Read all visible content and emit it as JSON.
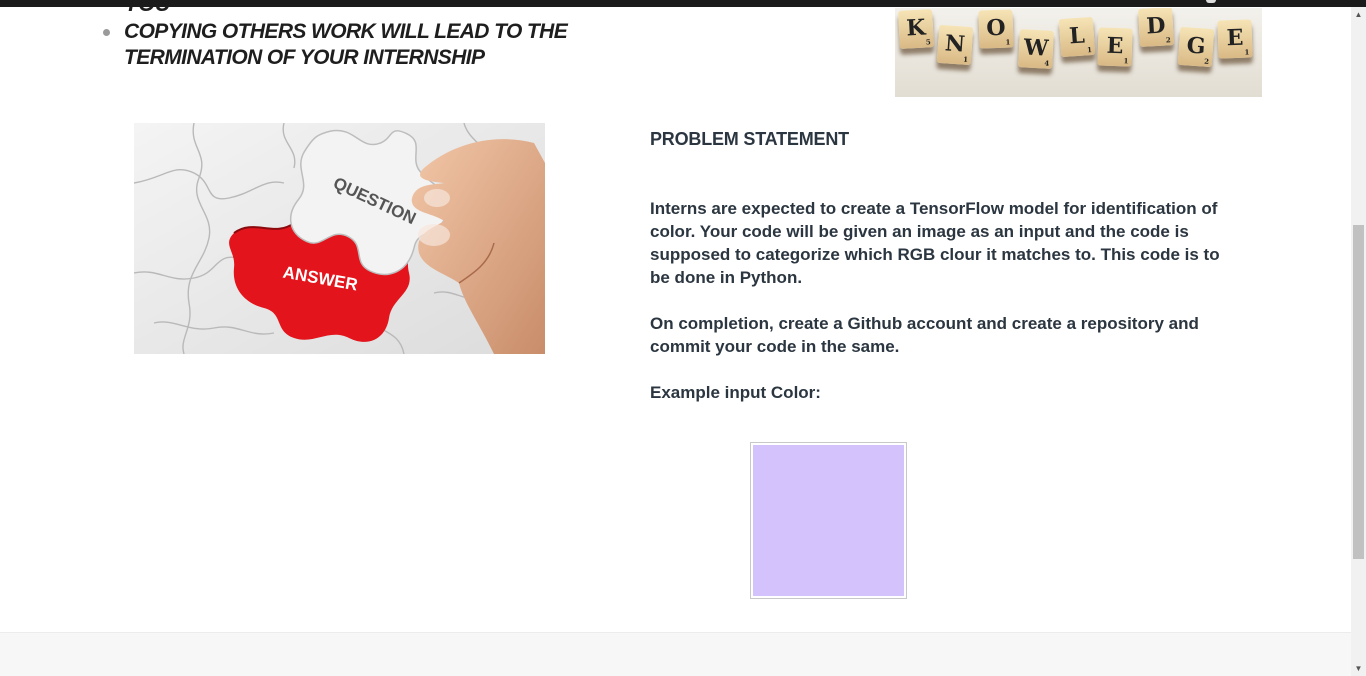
{
  "prior_text_fragment": "YOU",
  "rules_list": [
    "COPYING OTHERS WORK WILL LEAD TO THE TERMINATION OF YOUR INTERNSHIP"
  ],
  "knowledge_image": {
    "letters": [
      "K",
      "N",
      "O",
      "W",
      "L",
      "E",
      "D",
      "G",
      "E"
    ],
    "scores": [
      "5",
      "1",
      "1",
      "4",
      "1",
      "1",
      "2",
      "2",
      "1"
    ]
  },
  "puzzle_image": {
    "piece_top_label": "QUESTION",
    "piece_hole_label": "ANSWER"
  },
  "problem": {
    "heading": "PROBLEM STATEMENT",
    "paragraph_1": "Interns are expected to create a TensorFlow model for identification of color. Your code will be given an image as an input and the code is supposed to categorize which RGB clour it matches to. This code is to be done in Python.",
    "paragraph_2": "On completion, create a Github account and create a repository and commit your code in the same.",
    "example_label": "Example input Color:"
  },
  "example_color": "#d4c2fd",
  "colors": {
    "text": "#2b3640",
    "puzzle_red": "#e3141b",
    "topbar": "#1b1b1b"
  }
}
